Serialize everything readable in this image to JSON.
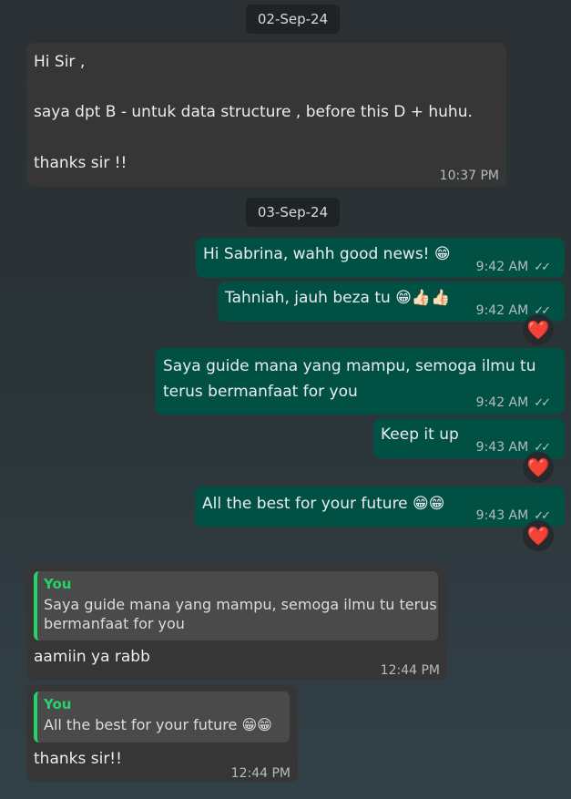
{
  "dates": [
    "02-Sep-24",
    "03-Sep-24"
  ],
  "messages": [
    {
      "lines": [
        "Hi Sir ,",
        "saya dpt B - untuk data structure , before this D + huhu.",
        "thanks sir !!"
      ],
      "time": "10:37 PM"
    },
    {
      "text": "Hi Sabrina, wahh good news! 😁",
      "time": "9:42 AM"
    },
    {
      "text": "Tahniah, jauh beza tu 😁👍🏻👍🏻",
      "time": "9:42 AM",
      "reaction": "❤️"
    },
    {
      "lines": [
        "Saya guide mana yang mampu, semoga ilmu tu",
        "terus bermanfaat for you"
      ],
      "time": "9:42 AM"
    },
    {
      "text": "Keep it up",
      "time": "9:43 AM",
      "reaction": "❤️"
    },
    {
      "text": "All the best for your future 😁😁",
      "time": "9:43 AM",
      "reaction": "❤️"
    },
    {
      "quote_author": "You",
      "quote_lines": [
        "Saya guide mana yang mampu, semoga ilmu tu terus",
        "bermanfaat for you"
      ],
      "text": "aamiin ya rabb",
      "time": "12:44 PM"
    },
    {
      "quote_author": "You",
      "quote_lines": [
        "All the best for your future 😁😁"
      ],
      "text": "thanks sir!!",
      "time": "12:44 PM"
    }
  ],
  "icons": {
    "read_ticks": "double-check-icon"
  }
}
